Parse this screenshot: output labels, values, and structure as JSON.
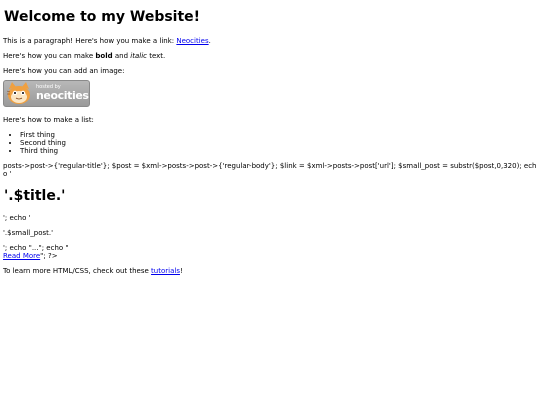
{
  "heading": "Welcome to my Website!",
  "para1": {
    "before": "This is a paragraph! Here's how you make a link: ",
    "link": "Neocities",
    "after": "."
  },
  "para2": {
    "before": "Here's how you can make ",
    "bold": "bold",
    "middle": " and ",
    "italic": "italic",
    "after": " text."
  },
  "image_intro": "Here's how you can add an image:",
  "badge": {
    "hosted": "hosted by",
    "brand": "neocities"
  },
  "list_intro": "Here's how to make a list:",
  "list_items": [
    "First thing",
    "Second thing",
    "Third thing"
  ],
  "php_line": "posts->post->{'regular-title'}; $post = $xml->posts->post->{'regular-body'}; $link = $xml->posts->post['url']; $small_post = substr($post,0,320); echo '",
  "php_title": "'.$title.'",
  "php_echo1": "'; echo '",
  "php_small": "'.$small_post.'",
  "php_echo2": "'; echo \"...\"; echo \"",
  "read_more": "Read More",
  "php_end": "\"; ?>",
  "outro": {
    "before": "To learn more HTML/CSS, check out these ",
    "link": "tutorials",
    "after": "!"
  },
  "colors": {
    "link": "#0000ee",
    "text": "#000000",
    "background": "#ffffff"
  }
}
